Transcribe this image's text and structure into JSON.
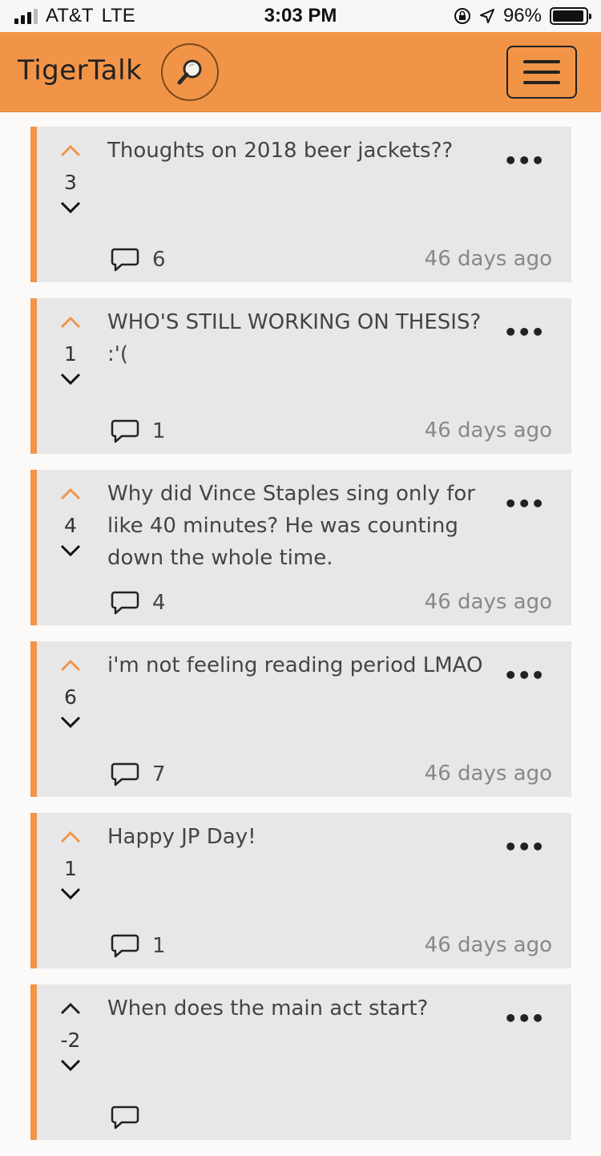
{
  "status": {
    "carrier": "AT&T",
    "network": "LTE",
    "time": "3:03 PM",
    "battery": "96%",
    "battery_level": 0.96
  },
  "header": {
    "brand": "TigerTalk"
  },
  "colors": {
    "accent": "#f29447",
    "card_bg": "#e7e7e9"
  },
  "posts": [
    {
      "text": "Thoughts on 2018 beer jackets??",
      "score": "3",
      "comments": "6",
      "age": "46 days ago"
    },
    {
      "text": "WHO'S STILL WORKING ON THESIS? :'(",
      "score": "1",
      "comments": "1",
      "age": "46 days ago"
    },
    {
      "text": "Why did Vince Staples sing only for like 40 minutes? He was counting down the whole time.",
      "score": "4",
      "comments": "4",
      "age": "46 days ago"
    },
    {
      "text": "i'm not feeling reading period LMAO",
      "score": "6",
      "comments": "7",
      "age": "46 days ago"
    },
    {
      "text": "Happy JP Day!",
      "score": "1",
      "comments": "1",
      "age": "46 days ago"
    },
    {
      "text": "When does the main act start?",
      "score": "-2",
      "comments": "",
      "age": ""
    }
  ]
}
